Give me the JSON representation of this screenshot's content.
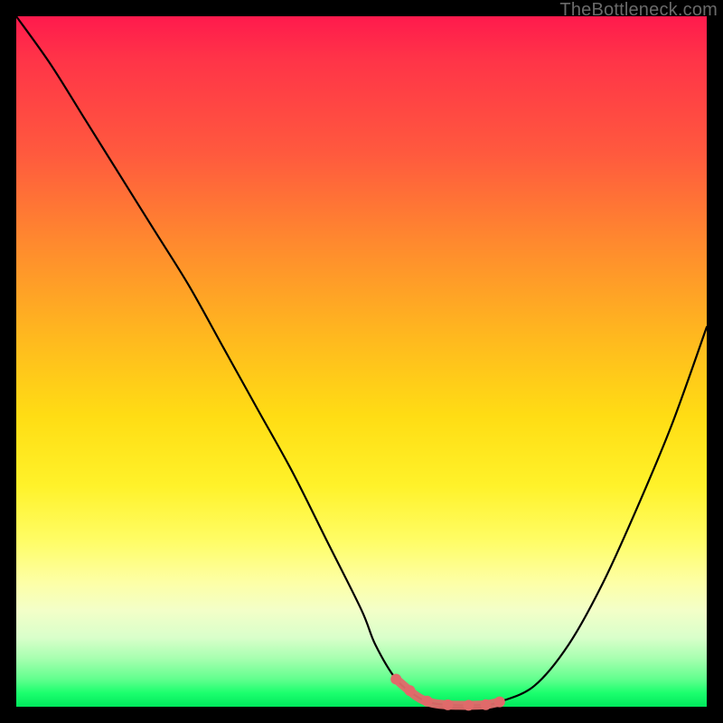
{
  "watermark": "TheBottleneck.com",
  "colors": {
    "background": "#000000",
    "curve_stroke": "#000000",
    "highlight_stroke": "#e06a6a",
    "watermark_text": "#6a6a6a"
  },
  "chart_data": {
    "type": "line",
    "title": "",
    "xlabel": "",
    "ylabel": "",
    "xlim": [
      0,
      100
    ],
    "ylim": [
      0,
      100
    ],
    "x": [
      0,
      5,
      10,
      15,
      20,
      25,
      30,
      35,
      40,
      45,
      50,
      52,
      55,
      58,
      60,
      62,
      65,
      68,
      70,
      75,
      80,
      85,
      90,
      95,
      100
    ],
    "values": [
      100,
      93,
      85,
      77,
      69,
      61,
      52,
      43,
      34,
      24,
      14,
      9,
      4,
      1.5,
      0.6,
      0.3,
      0.2,
      0.3,
      0.7,
      3,
      9,
      18,
      29,
      41,
      55
    ],
    "highlight_x_range": [
      55,
      70
    ],
    "note": "Values are estimated from the pixel curve; x is horizontal position % across plot, values are height above bottom as % of plot height. Highlight marks the flat bottom of the valley where the pink overlay appears."
  }
}
